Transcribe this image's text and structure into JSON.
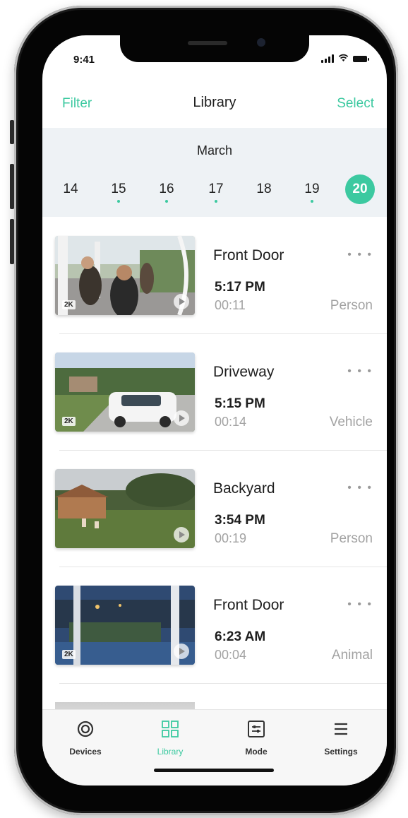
{
  "status": {
    "time": "9:41"
  },
  "nav": {
    "filter_label": "Filter",
    "title": "Library",
    "select_label": "Select"
  },
  "calendar": {
    "month": "March",
    "days": [
      {
        "day": "14",
        "has_events": false,
        "selected": false
      },
      {
        "day": "15",
        "has_events": true,
        "selected": false
      },
      {
        "day": "16",
        "has_events": true,
        "selected": false
      },
      {
        "day": "17",
        "has_events": true,
        "selected": false
      },
      {
        "day": "18",
        "has_events": false,
        "selected": false
      },
      {
        "day": "19",
        "has_events": true,
        "selected": false
      },
      {
        "day": "20",
        "has_events": false,
        "selected": true
      }
    ]
  },
  "events": [
    {
      "camera": "Front Door",
      "time": "5:17 PM",
      "duration": "00:11",
      "type": "Person",
      "badge": "2K"
    },
    {
      "camera": "Driveway",
      "time": "5:15 PM",
      "duration": "00:14",
      "type": "Vehicle",
      "badge": "2K"
    },
    {
      "camera": "Backyard",
      "time": "3:54 PM",
      "duration": "00:19",
      "type": "Person",
      "badge": ""
    },
    {
      "camera": "Front Door",
      "time": "6:23 AM",
      "duration": "00:04",
      "type": "Animal",
      "badge": "2K"
    }
  ],
  "more_label": "• • •",
  "tabs": [
    {
      "label": "Devices",
      "icon": "devices-icon",
      "active": false
    },
    {
      "label": "Library",
      "icon": "library-icon",
      "active": true
    },
    {
      "label": "Mode",
      "icon": "mode-icon",
      "active": false
    },
    {
      "label": "Settings",
      "icon": "menu-icon",
      "active": false
    }
  ],
  "colors": {
    "accent": "#3cc9a0",
    "date_bar": "#eef2f5"
  }
}
